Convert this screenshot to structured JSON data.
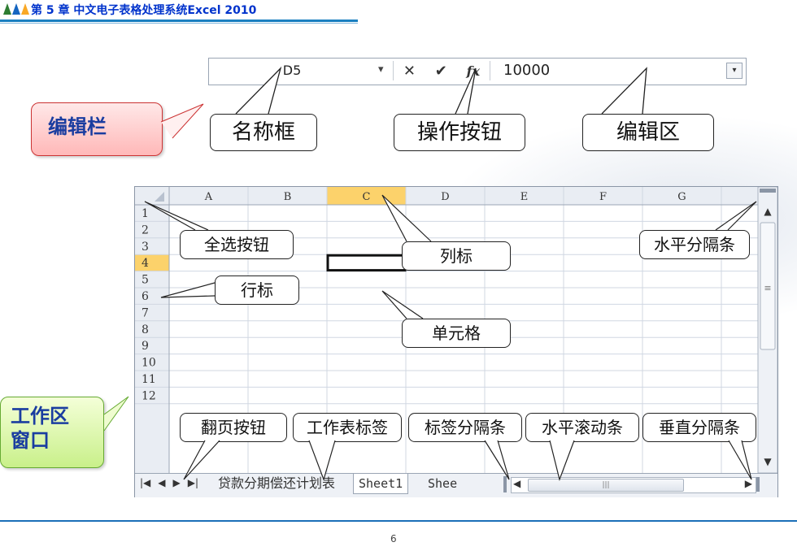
{
  "header": {
    "title": "第 5 章   中文电子表格处理系统Excel 2010",
    "icon_colors": [
      "#2e7d32",
      "#1565c0",
      "#f9a825"
    ]
  },
  "formula_bar": {
    "name_box": "D5",
    "dropdown_glyph": "▾",
    "cancel_glyph": "✕",
    "enter_glyph": "✔",
    "fx_glyph": "fx",
    "value": "10000",
    "expand_glyph": "▾"
  },
  "callouts": {
    "edit_bar": "编辑栏",
    "name_box": "名称框",
    "operation_buttons": "操作按钮",
    "edit_area": "编辑区",
    "select_all": "全选按钮",
    "column_header": "列标",
    "horizontal_split": "水平分隔条",
    "row_header": "行标",
    "cell": "单元格",
    "workspace_line1": "工作区",
    "workspace_line2": "窗口",
    "page_buttons": "翻页按钮",
    "sheet_tabs": "工作表标签",
    "tab_split": "标签分隔条",
    "hscroll": "水平滚动条",
    "vertical_split": "垂直分隔条"
  },
  "sheet": {
    "columns": [
      "A",
      "B",
      "C",
      "D",
      "E",
      "F",
      "G"
    ],
    "rows": [
      "1",
      "2",
      "3",
      "4",
      "5",
      "6",
      "7",
      "8",
      "9",
      "10",
      "11",
      "12"
    ],
    "selected_column": "C",
    "selected_row": "4",
    "tabs": [
      "贷款分期偿还计划表",
      "Sheet1",
      "Shee"
    ],
    "nav_glyphs": [
      "|◀",
      "◀",
      "▶",
      "▶|"
    ],
    "hscroll_thumb_glyph": "|||",
    "vscroll_thumb_glyph": "≡",
    "highlight_color": "#fcd26b"
  },
  "footer": {
    "page": "6"
  }
}
